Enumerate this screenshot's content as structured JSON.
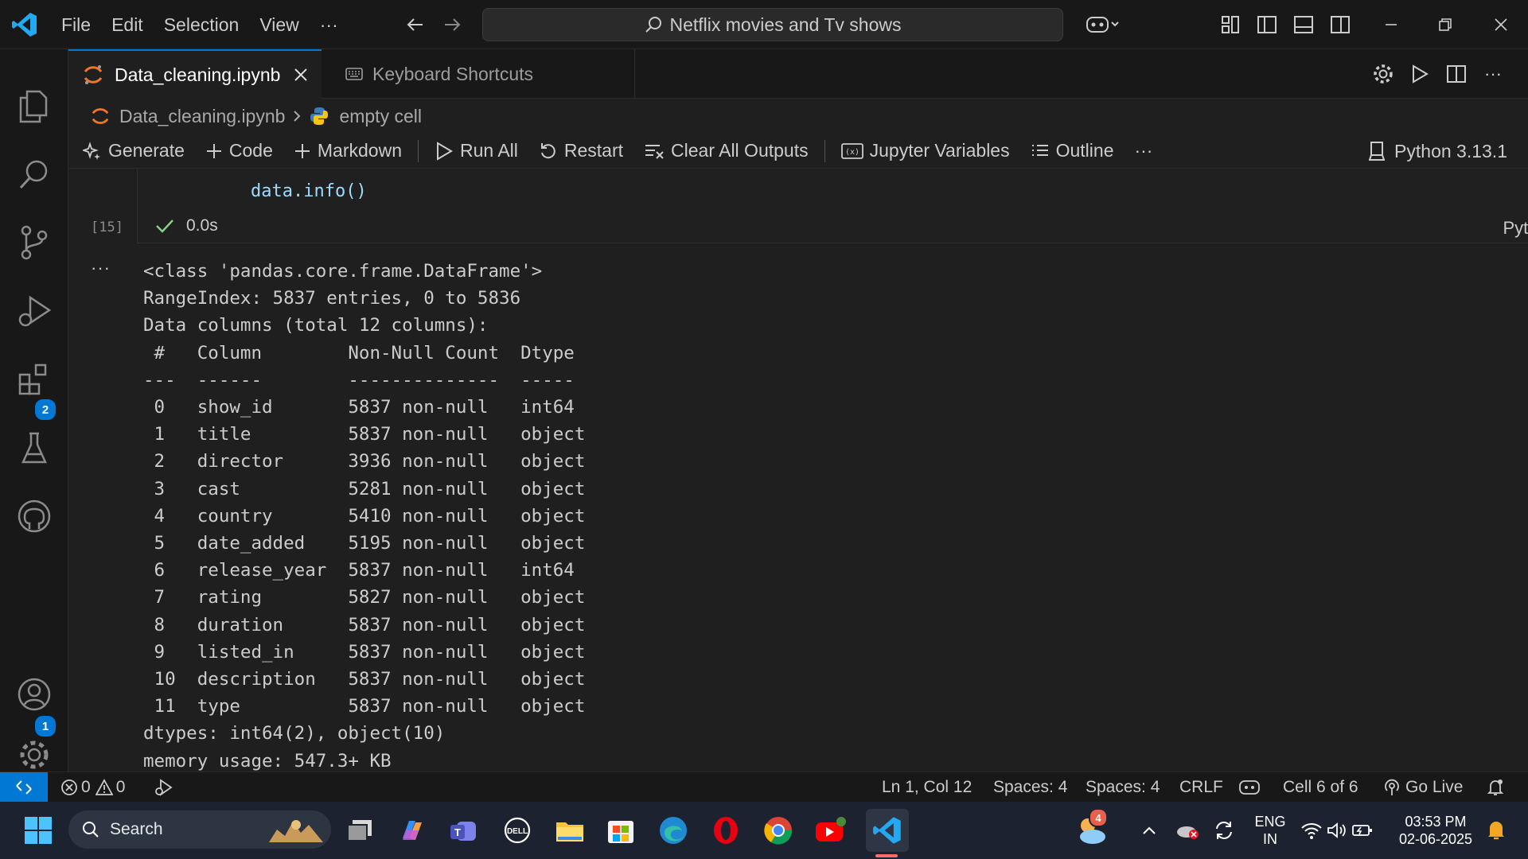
{
  "menu": {
    "file": "File",
    "edit": "Edit",
    "selection": "Selection",
    "view": "View",
    "more": "···"
  },
  "search": {
    "text": "Netflix movies and Tv shows"
  },
  "tabs": [
    {
      "label": "Data_cleaning.ipynb",
      "active": true
    },
    {
      "label": "Keyboard Shortcuts",
      "active": false
    }
  ],
  "breadcrumb": {
    "file": "Data_cleaning.ipynb",
    "cell": "empty cell"
  },
  "toolbar": {
    "generate": "Generate",
    "code": "Code",
    "markdown": "Markdown",
    "run_all": "Run All",
    "restart": "Restart",
    "clear_outputs": "Clear All Outputs",
    "variables": "Jupyter Variables",
    "outline": "Outline",
    "more": "···",
    "kernel": "Python 3.13.1"
  },
  "cell": {
    "code": "data.info()",
    "exec_count": "[15]",
    "duration": "0.0s",
    "language": "Python",
    "output_marker": "···",
    "output_lines": [
      "<class 'pandas.core.frame.DataFrame'>",
      "RangeIndex: 5837 entries, 0 to 5836",
      "Data columns (total 12 columns):",
      " #   Column        Non-Null Count  Dtype ",
      "---  ------        --------------  ----- ",
      " 0   show_id       5837 non-null   int64 ",
      " 1   title         5837 non-null   object",
      " 2   director      3936 non-null   object",
      " 3   cast          5281 non-null   object",
      " 4   country       5410 non-null   object",
      " 5   date_added    5195 non-null   object",
      " 6   release_year  5837 non-null   int64 ",
      " 7   rating        5827 non-null   object",
      " 8   duration      5837 non-null   object",
      " 9   listed_in     5837 non-null   object",
      " 10  description   5837 non-null   object",
      " 11  type          5837 non-null   object",
      "dtypes: int64(2), object(10)",
      "memory usage: 547.3+ KB"
    ]
  },
  "activity_badges": {
    "extensions": "2",
    "accounts": "1",
    "settings": "1"
  },
  "statusbar": {
    "errors": "0",
    "warnings": "0",
    "position": "Ln 1, Col 12",
    "spaces1": "Spaces: 4",
    "spaces2": "Spaces: 4",
    "eol": "CRLF",
    "cell_info": "Cell 6 of 6",
    "go_live": "Go Live"
  },
  "taskbar": {
    "search": "Search",
    "weather_badge": "4",
    "lang_line1": "ENG",
    "lang_line2": "IN",
    "time": "03:53 PM",
    "date": "02-06-2025"
  },
  "colors": {
    "accent": "#0078d4",
    "bg": "#1f1f1f",
    "sidebar": "#181818",
    "check": "#89d185"
  }
}
